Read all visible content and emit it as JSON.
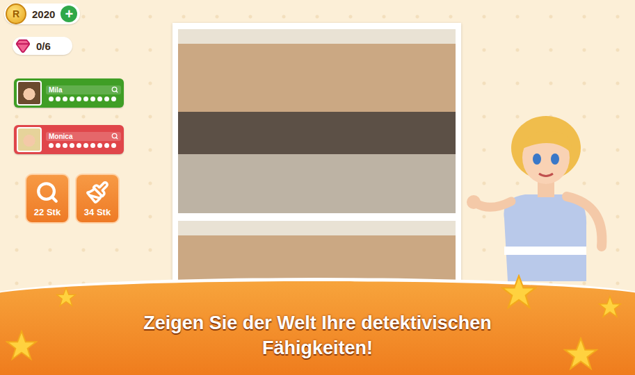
{
  "currency": {
    "coin_symbol": "R",
    "coins": "2020",
    "add": "+"
  },
  "gems": {
    "count": "0/6"
  },
  "players": [
    {
      "name": "Mila",
      "color": "#3f9e25",
      "marks": [
        false,
        false,
        false,
        false,
        false,
        false,
        false,
        false,
        false,
        false
      ]
    },
    {
      "name": "Monica",
      "color": "#e0464a",
      "marks": [
        false,
        false,
        false,
        false,
        false,
        false,
        false,
        false,
        false,
        false
      ]
    }
  ],
  "tools": [
    {
      "kind": "hint",
      "count": "22 Stk"
    },
    {
      "kind": "brush",
      "count": "34 Stk"
    }
  ],
  "banner": {
    "lines": [
      "Zeigen Sie der Welt Ihre detektivischen",
      "Fähigkeiten!"
    ]
  }
}
